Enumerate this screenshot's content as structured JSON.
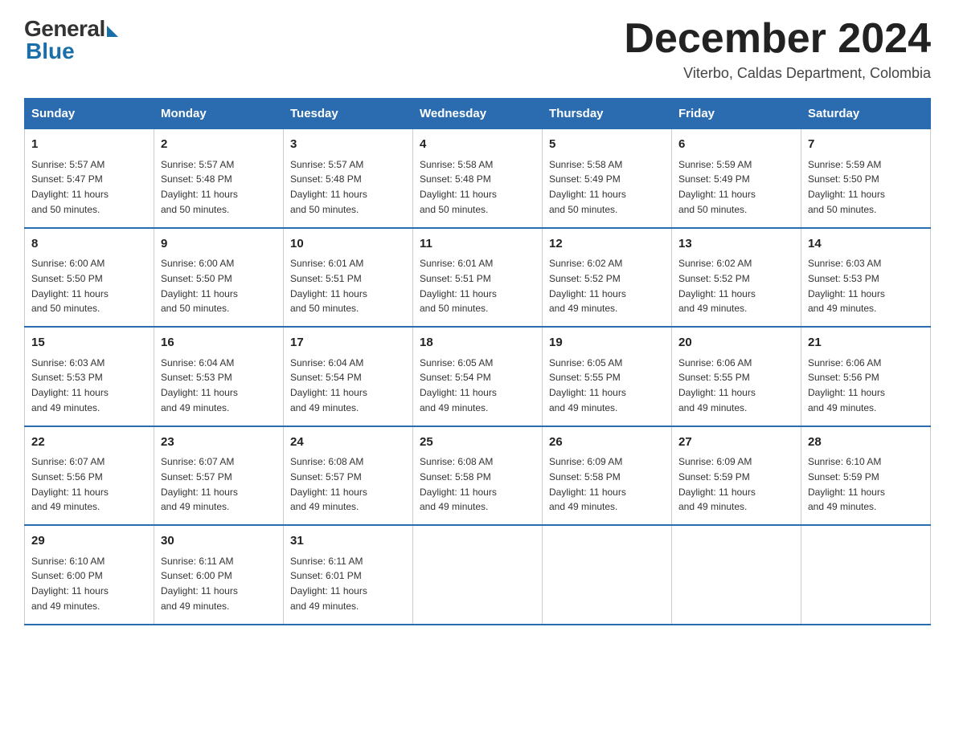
{
  "logo": {
    "general": "General",
    "blue": "Blue"
  },
  "title": "December 2024",
  "location": "Viterbo, Caldas Department, Colombia",
  "days_of_week": [
    "Sunday",
    "Monday",
    "Tuesday",
    "Wednesday",
    "Thursday",
    "Friday",
    "Saturday"
  ],
  "weeks": [
    [
      {
        "day": "1",
        "sunrise": "5:57 AM",
        "sunset": "5:47 PM",
        "daylight": "11 hours and 50 minutes."
      },
      {
        "day": "2",
        "sunrise": "5:57 AM",
        "sunset": "5:48 PM",
        "daylight": "11 hours and 50 minutes."
      },
      {
        "day": "3",
        "sunrise": "5:57 AM",
        "sunset": "5:48 PM",
        "daylight": "11 hours and 50 minutes."
      },
      {
        "day": "4",
        "sunrise": "5:58 AM",
        "sunset": "5:48 PM",
        "daylight": "11 hours and 50 minutes."
      },
      {
        "day": "5",
        "sunrise": "5:58 AM",
        "sunset": "5:49 PM",
        "daylight": "11 hours and 50 minutes."
      },
      {
        "day": "6",
        "sunrise": "5:59 AM",
        "sunset": "5:49 PM",
        "daylight": "11 hours and 50 minutes."
      },
      {
        "day": "7",
        "sunrise": "5:59 AM",
        "sunset": "5:50 PM",
        "daylight": "11 hours and 50 minutes."
      }
    ],
    [
      {
        "day": "8",
        "sunrise": "6:00 AM",
        "sunset": "5:50 PM",
        "daylight": "11 hours and 50 minutes."
      },
      {
        "day": "9",
        "sunrise": "6:00 AM",
        "sunset": "5:50 PM",
        "daylight": "11 hours and 50 minutes."
      },
      {
        "day": "10",
        "sunrise": "6:01 AM",
        "sunset": "5:51 PM",
        "daylight": "11 hours and 50 minutes."
      },
      {
        "day": "11",
        "sunrise": "6:01 AM",
        "sunset": "5:51 PM",
        "daylight": "11 hours and 50 minutes."
      },
      {
        "day": "12",
        "sunrise": "6:02 AM",
        "sunset": "5:52 PM",
        "daylight": "11 hours and 49 minutes."
      },
      {
        "day": "13",
        "sunrise": "6:02 AM",
        "sunset": "5:52 PM",
        "daylight": "11 hours and 49 minutes."
      },
      {
        "day": "14",
        "sunrise": "6:03 AM",
        "sunset": "5:53 PM",
        "daylight": "11 hours and 49 minutes."
      }
    ],
    [
      {
        "day": "15",
        "sunrise": "6:03 AM",
        "sunset": "5:53 PM",
        "daylight": "11 hours and 49 minutes."
      },
      {
        "day": "16",
        "sunrise": "6:04 AM",
        "sunset": "5:53 PM",
        "daylight": "11 hours and 49 minutes."
      },
      {
        "day": "17",
        "sunrise": "6:04 AM",
        "sunset": "5:54 PM",
        "daylight": "11 hours and 49 minutes."
      },
      {
        "day": "18",
        "sunrise": "6:05 AM",
        "sunset": "5:54 PM",
        "daylight": "11 hours and 49 minutes."
      },
      {
        "day": "19",
        "sunrise": "6:05 AM",
        "sunset": "5:55 PM",
        "daylight": "11 hours and 49 minutes."
      },
      {
        "day": "20",
        "sunrise": "6:06 AM",
        "sunset": "5:55 PM",
        "daylight": "11 hours and 49 minutes."
      },
      {
        "day": "21",
        "sunrise": "6:06 AM",
        "sunset": "5:56 PM",
        "daylight": "11 hours and 49 minutes."
      }
    ],
    [
      {
        "day": "22",
        "sunrise": "6:07 AM",
        "sunset": "5:56 PM",
        "daylight": "11 hours and 49 minutes."
      },
      {
        "day": "23",
        "sunrise": "6:07 AM",
        "sunset": "5:57 PM",
        "daylight": "11 hours and 49 minutes."
      },
      {
        "day": "24",
        "sunrise": "6:08 AM",
        "sunset": "5:57 PM",
        "daylight": "11 hours and 49 minutes."
      },
      {
        "day": "25",
        "sunrise": "6:08 AM",
        "sunset": "5:58 PM",
        "daylight": "11 hours and 49 minutes."
      },
      {
        "day": "26",
        "sunrise": "6:09 AM",
        "sunset": "5:58 PM",
        "daylight": "11 hours and 49 minutes."
      },
      {
        "day": "27",
        "sunrise": "6:09 AM",
        "sunset": "5:59 PM",
        "daylight": "11 hours and 49 minutes."
      },
      {
        "day": "28",
        "sunrise": "6:10 AM",
        "sunset": "5:59 PM",
        "daylight": "11 hours and 49 minutes."
      }
    ],
    [
      {
        "day": "29",
        "sunrise": "6:10 AM",
        "sunset": "6:00 PM",
        "daylight": "11 hours and 49 minutes."
      },
      {
        "day": "30",
        "sunrise": "6:11 AM",
        "sunset": "6:00 PM",
        "daylight": "11 hours and 49 minutes."
      },
      {
        "day": "31",
        "sunrise": "6:11 AM",
        "sunset": "6:01 PM",
        "daylight": "11 hours and 49 minutes."
      },
      null,
      null,
      null,
      null
    ]
  ],
  "labels": {
    "sunrise": "Sunrise:",
    "sunset": "Sunset:",
    "daylight": "Daylight:"
  }
}
